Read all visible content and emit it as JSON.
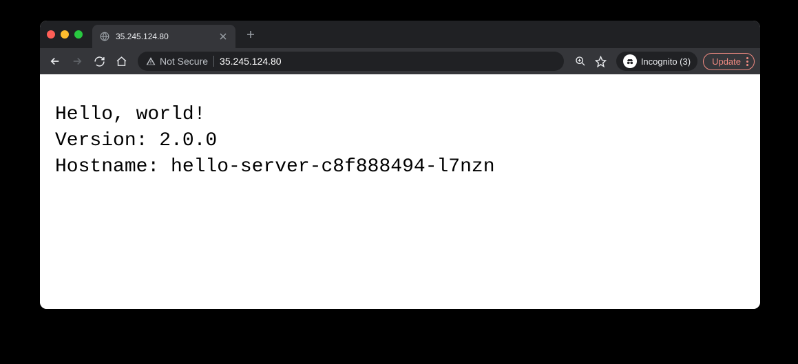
{
  "window": {
    "tab": {
      "title": "35.245.124.80"
    },
    "toolbar": {
      "not_secure_label": "Not Secure",
      "url": "35.245.124.80",
      "incognito_label": "Incognito (3)",
      "update_label": "Update"
    }
  },
  "page": {
    "line1": "Hello, world!",
    "line2": "Version: 2.0.0",
    "line3": "Hostname: hello-server-c8f888494-l7nzn"
  }
}
